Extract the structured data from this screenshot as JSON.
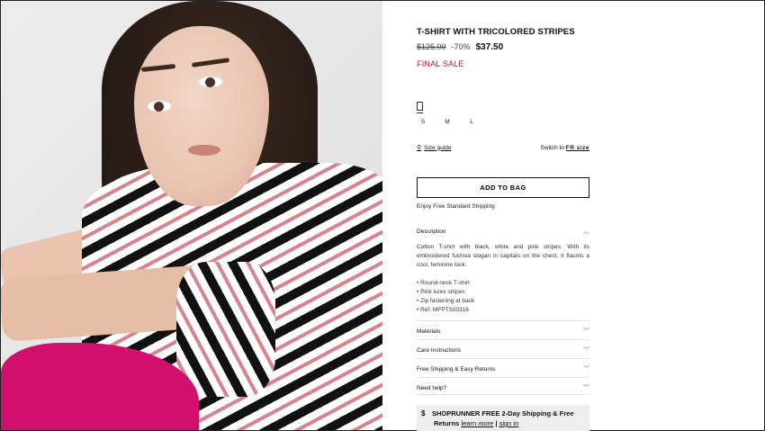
{
  "product": {
    "title": "T-SHIRT WITH TRICOLORED STRIPES",
    "price_original": "$125.00",
    "discount": "-70%",
    "price_sale": "$37.50",
    "sale_label": "FINAL SALE"
  },
  "sizes": [
    "S",
    "M",
    "L"
  ],
  "size_guide": {
    "link_label": "Size guide",
    "switch_prefix": "Switch to",
    "switch_target": "FR size"
  },
  "actions": {
    "add_to_bag": "ADD TO BAG",
    "shipping_note": "Enjoy Free Standard Shipping"
  },
  "description": {
    "heading": "Description",
    "text": "Cotton T-shirt with black, white and pink stripes. With its embroidered fuchsia slogan in capitals on the chest, it flaunts a cool, feminine look.",
    "bullets": [
      "Round-neck T-shirt",
      "Pink lurex stripes",
      "Zip fastening at back",
      "Ref: MFPTS00316"
    ]
  },
  "sections": [
    {
      "label": "Materials"
    },
    {
      "label": "Care Instructions"
    },
    {
      "label": "Free Shipping & Easy Returns"
    },
    {
      "label": "Need help?"
    }
  ],
  "promo": {
    "logo": "$",
    "line1": "SHOPRUNNER FREE 2-Day Shipping & Free",
    "line2_prefix": "Returns",
    "learn_more": "learn more",
    "separator": "|",
    "sign_in": "sign in"
  },
  "colors": {
    "sale_red": "#c8102e",
    "stripe_pink": "#d9838e",
    "pants_fuchsia": "#d1106e"
  },
  "icons": {
    "hanger": "hanger-icon",
    "chevron_up": "chevron-up-icon",
    "chevron_down": "chevron-down-icon"
  }
}
